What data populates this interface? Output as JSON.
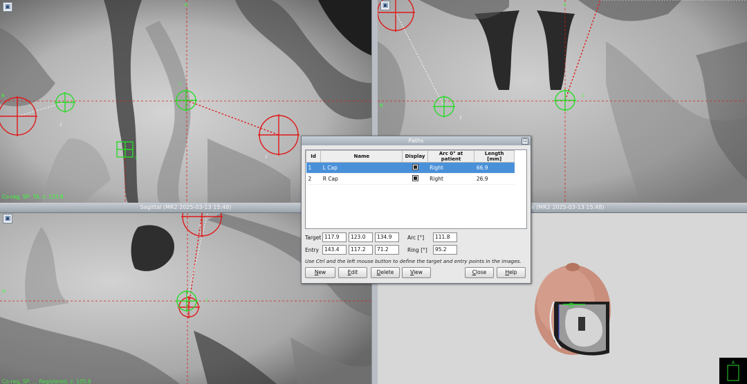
{
  "viewports": {
    "axial": {
      "orientation_label": "A",
      "left_label": "R",
      "status": "Co-reg, SP: 76, z: 133.8",
      "marker_labels": [
        "1",
        "2",
        "2",
        "1"
      ]
    },
    "coronal": {
      "orientation_label": "S",
      "left_label": "R",
      "marker_labels": [
        "1",
        "2"
      ]
    },
    "sagittal": {
      "title": "Sagittal (MR2 2025-03-13 15:48)",
      "left_label": "A",
      "status": "Co-reg, SP: ... Registered, z: 105.8",
      "marker_labels": [
        "2",
        "1"
      ]
    },
    "box3d": {
      "title": "t box (MR2 2025-03-13 15:48)"
    }
  },
  "dialog": {
    "title": "Paths",
    "columns": [
      "Id",
      "Name",
      "Display",
      "Arc 0° at patient",
      "Length [mm]"
    ],
    "rows": [
      {
        "id": "1",
        "name": "L Cap",
        "display": true,
        "arc": "Right",
        "length": "66.9",
        "selected": true
      },
      {
        "id": "2",
        "name": "R Cap",
        "display": true,
        "arc": "Right",
        "length": "26.9",
        "selected": false
      }
    ],
    "target_label": "Target",
    "target": [
      "117.9",
      "123.0",
      "134.9"
    ],
    "entry_label": "Entry",
    "entry": [
      "143.4",
      "117.2",
      "71.2"
    ],
    "arc_label": "Arc [°]",
    "arc": "111.8",
    "ring_label": "Ring [°]",
    "ring": "95.2",
    "hint": "Use Ctrl and the left mouse button to define the target and entry points in the images.",
    "buttons": {
      "new": "New",
      "edit": "Edit",
      "delete": "Delete",
      "view": "View",
      "close": "Close",
      "help": "Help"
    }
  },
  "colors": {
    "target_green": "#2bd92b",
    "entry_red": "#e01818",
    "selection_blue": "#4a90d9"
  }
}
